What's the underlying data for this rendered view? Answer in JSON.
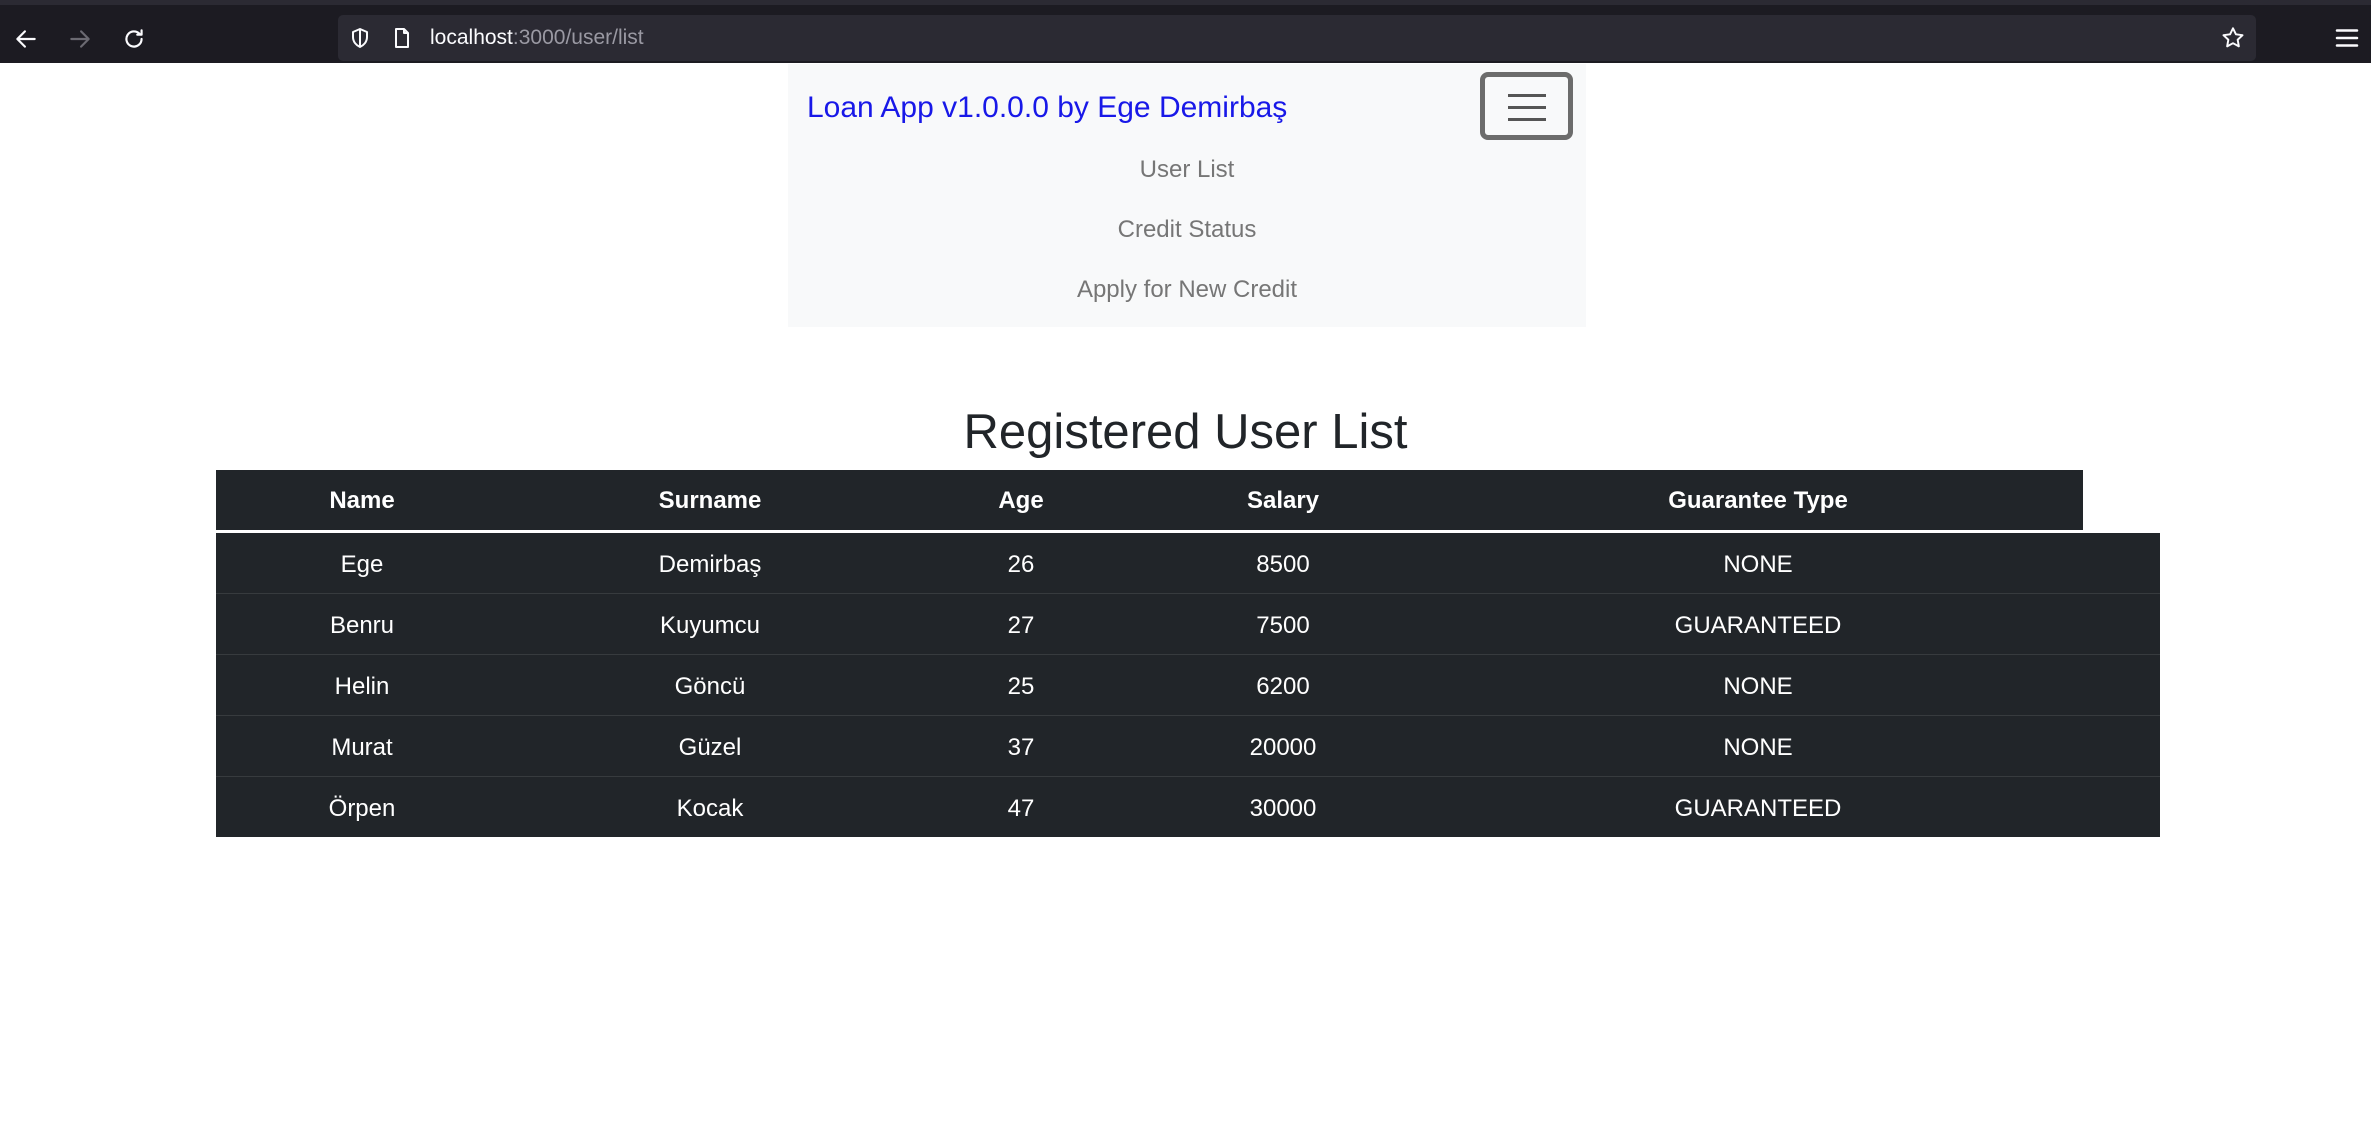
{
  "browser": {
    "url_host": "localhost",
    "url_rest": ":3000/user/list"
  },
  "navbar": {
    "brand": "Loan App v1.0.0.0 by Ege Demirbaş",
    "links": [
      {
        "label": "User List"
      },
      {
        "label": "Credit Status"
      },
      {
        "label": "Apply for New Credit"
      }
    ]
  },
  "page": {
    "title": "Registered User List"
  },
  "table": {
    "columns": [
      "Name",
      "Surname",
      "Age",
      "Salary",
      "Guarantee Type"
    ],
    "rows": [
      [
        "Ege",
        "Demirbaş",
        "26",
        "8500",
        "NONE"
      ],
      [
        "Benru",
        "Kuyumcu",
        "27",
        "7500",
        "GUARANTEED"
      ],
      [
        "Helin",
        "Göncü",
        "25",
        "6200",
        "NONE"
      ],
      [
        "Murat",
        "Güzel",
        "37",
        "20000",
        "NONE"
      ],
      [
        "Örpen",
        "Kocak",
        "47",
        "30000",
        "GUARANTEED"
      ]
    ]
  },
  "colors": {
    "browser_chrome": "#1c1b22",
    "url_bar": "#2b2a33",
    "navbar_bg": "#f8f9fa",
    "brand": "#1818e8",
    "nav_link": "#767676",
    "table_bg": "#212529"
  },
  "icons": [
    "back-arrow-icon",
    "forward-arrow-icon",
    "reload-icon",
    "shield-icon",
    "page-icon",
    "star-icon",
    "hamburger-menu-icon"
  ]
}
